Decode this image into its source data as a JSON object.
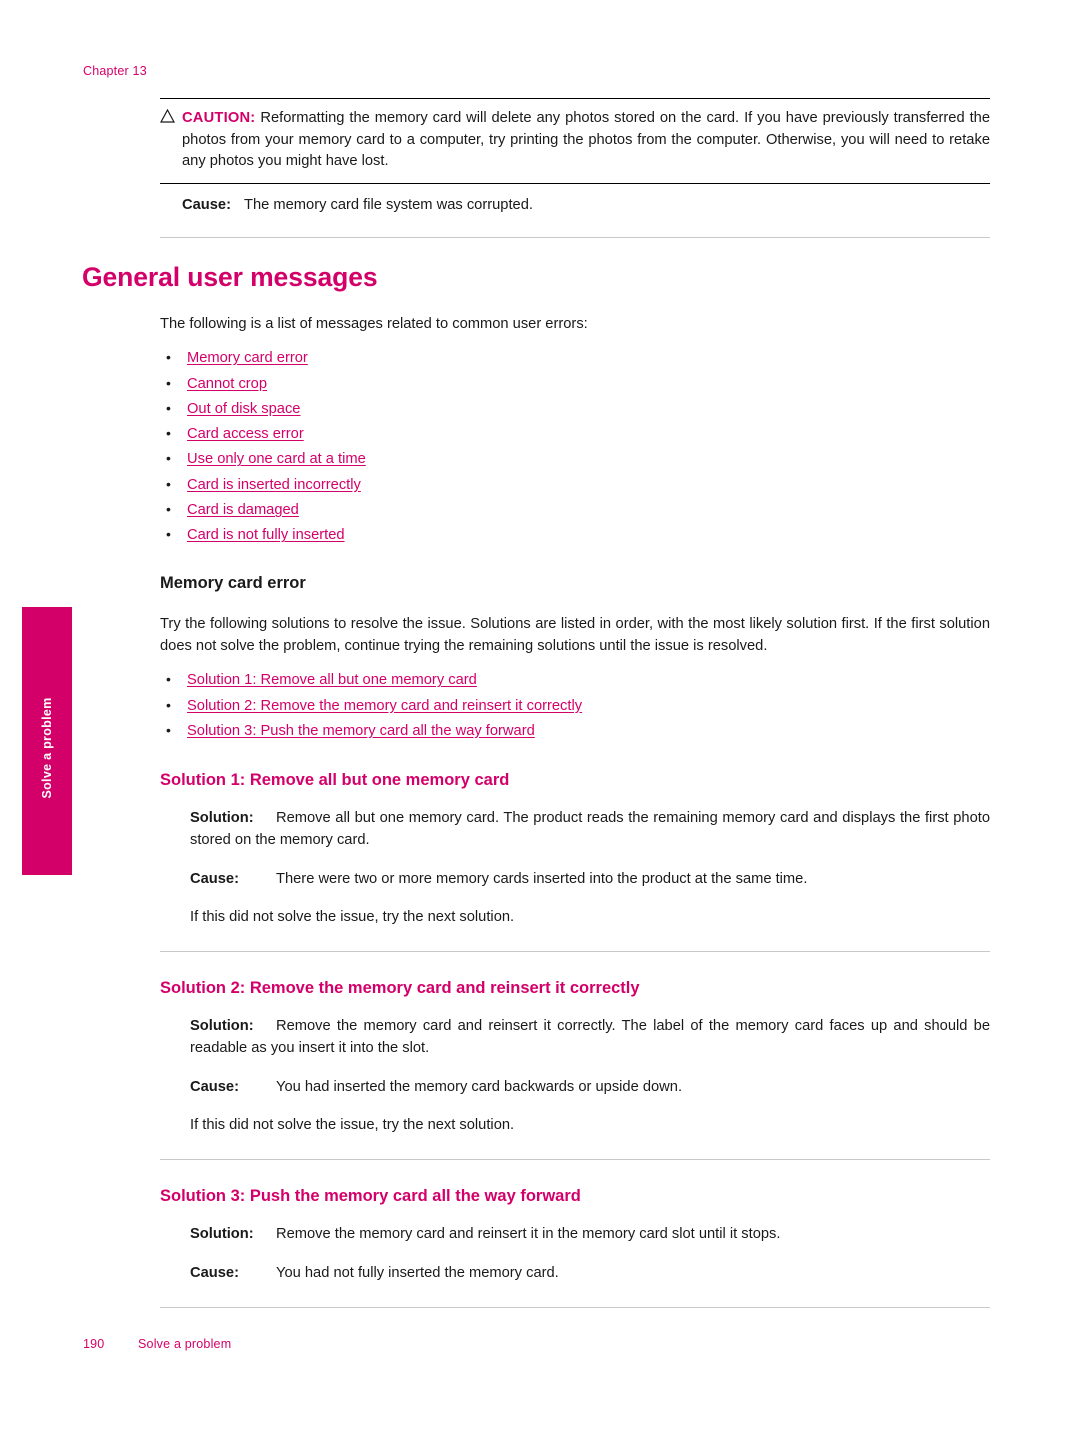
{
  "header": {
    "chapter": "Chapter 13"
  },
  "side_tab": {
    "label": "Solve a problem"
  },
  "caution": {
    "label": "CAUTION:",
    "text": "Reformatting the memory card will delete any photos stored on the card. If you have previously transferred the photos from your memory card to a computer, try printing the photos from the computer. Otherwise, you will need to retake any photos you might have lost."
  },
  "first_cause": {
    "label": "Cause:",
    "text": "The memory card file system was corrupted."
  },
  "section": {
    "title": "General user messages",
    "intro": "The following is a list of messages related to common user errors:",
    "links": [
      "Memory card error",
      "Cannot crop",
      "Out of disk space",
      "Card access error",
      "Use only one card at a time",
      "Card is inserted incorrectly",
      "Card is damaged",
      "Card is not fully inserted"
    ]
  },
  "memory_card_error": {
    "heading": "Memory card error",
    "intro": "Try the following solutions to resolve the issue. Solutions are listed in order, with the most likely solution first. If the first solution does not solve the problem, continue trying the remaining solutions until the issue is resolved.",
    "links": [
      "Solution 1: Remove all but one memory card",
      "Solution 2: Remove the memory card and reinsert it correctly",
      "Solution 3: Push the memory card all the way forward"
    ]
  },
  "solutions": [
    {
      "heading": "Solution 1: Remove all but one memory card",
      "solution_label": "Solution:",
      "solution_text": "Remove all but one memory card. The product reads the remaining memory card and displays the first photo stored on the memory card.",
      "cause_label": "Cause:",
      "cause_text": "There were two or more memory cards inserted into the product at the same time.",
      "next": "If this did not solve the issue, try the next solution."
    },
    {
      "heading": "Solution 2: Remove the memory card and reinsert it correctly",
      "solution_label": "Solution:",
      "solution_text": "Remove the memory card and reinsert it correctly. The label of the memory card faces up and should be readable as you insert it into the slot.",
      "cause_label": "Cause:",
      "cause_text": "You had inserted the memory card backwards or upside down.",
      "next": "If this did not solve the issue, try the next solution."
    },
    {
      "heading": "Solution 3: Push the memory card all the way forward",
      "solution_label": "Solution:",
      "solution_text": "Remove the memory card and reinsert it in the memory card slot until it stops.",
      "cause_label": "Cause:",
      "cause_text": "You had not fully inserted the memory card.",
      "next": ""
    }
  ],
  "footer": {
    "page_number": "190",
    "section_name": "Solve a problem"
  },
  "colors": {
    "accent": "#d4006a",
    "text": "#1a1a1a",
    "rule": "#c9c9c9"
  }
}
